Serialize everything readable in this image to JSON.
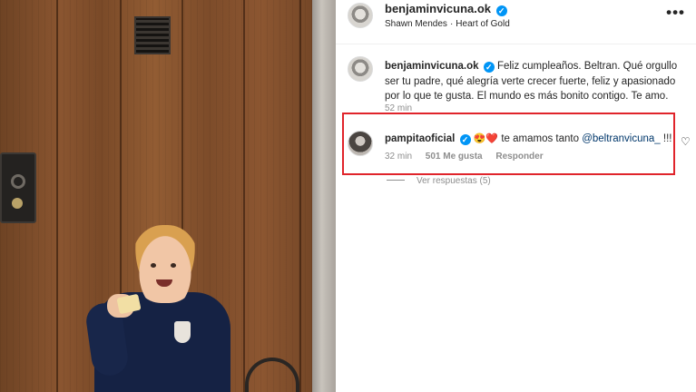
{
  "post": {
    "author": "benjaminvicuna.ok",
    "audio_artist": "Shawn Mendes",
    "audio_separator": "·",
    "audio_track": "Heart of Gold",
    "more_label": "•••"
  },
  "caption": {
    "username": "benjaminvicuna.ok",
    "text": "Feliz cumpleaños. Beltran. Qué orgullo ser tu padre, qué alegría verte crecer fuerte, feliz y apasionado por lo que te gusta. El mundo es más bonito contigo. Te amo.",
    "time": "52 min"
  },
  "comment": {
    "username": "pampitaoficial",
    "emojis": "😍❤️",
    "text_before": "te amamos tanto",
    "mention": "@beltranvicuna_",
    "text_after": "!!!",
    "time": "32 min",
    "likes": "501 Me gusta",
    "reply_label": "Responder",
    "view_replies": "Ver respuestas (5)"
  },
  "icons": {
    "verified": "verified-badge-icon",
    "like": "heart-outline-icon",
    "more": "more-options-icon"
  },
  "colors": {
    "verified": "#0095f6",
    "highlight_box": "#e0242b",
    "mention": "#00376b",
    "secondary_text": "#8e8e8e"
  }
}
